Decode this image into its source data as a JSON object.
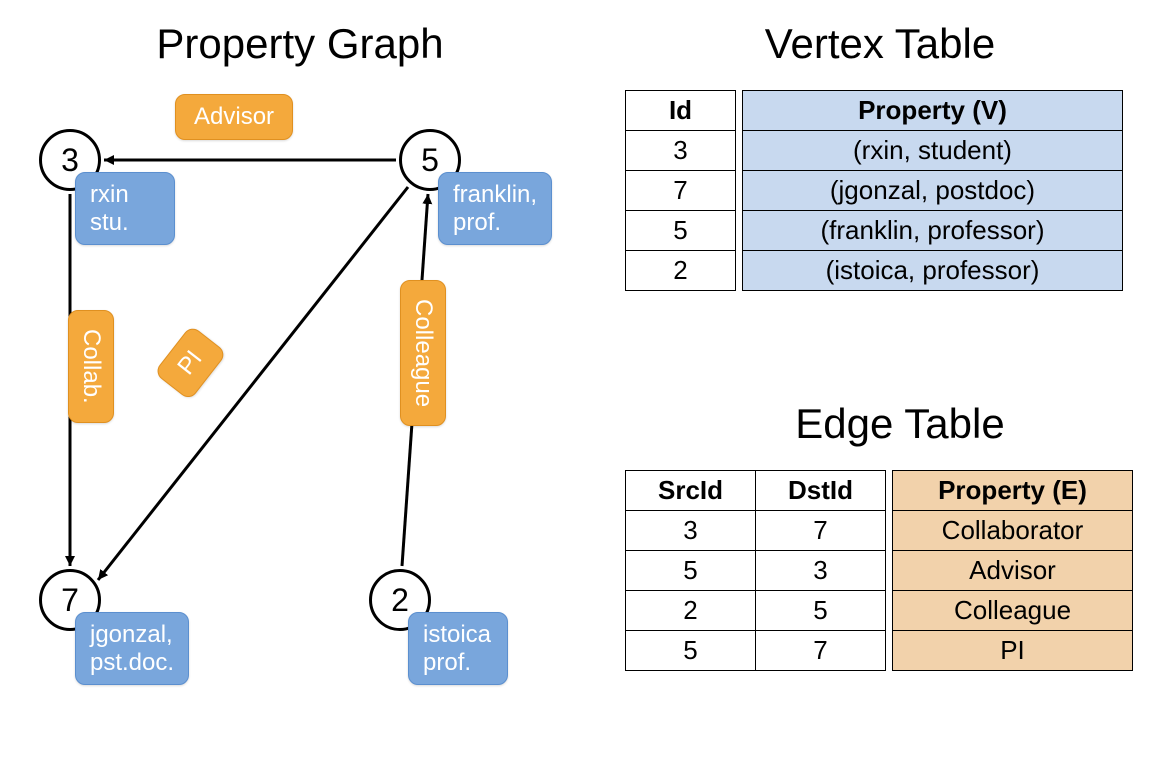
{
  "titles": {
    "graph": "Property Graph",
    "vertex_table": "Vertex Table",
    "edge_table": "Edge Table"
  },
  "vertices": {
    "v3": {
      "id": "3",
      "label_line1": "rxin",
      "label_line2": "stu."
    },
    "v5": {
      "id": "5",
      "label_line1": "franklin,",
      "label_line2": "prof."
    },
    "v7": {
      "id": "7",
      "label_line1": "jgonzal,",
      "label_line2": "pst.doc."
    },
    "v2": {
      "id": "2",
      "label_line1": "istoica",
      "label_line2": "prof."
    }
  },
  "edge_labels": {
    "advisor": "Advisor",
    "collab": "Collab.",
    "pi": "PI",
    "colleague": "Colleague"
  },
  "vertex_table": {
    "headers": {
      "id": "Id",
      "prop": "Property (V)"
    },
    "rows": [
      {
        "id": "3",
        "prop": "(rxin, student)"
      },
      {
        "id": "7",
        "prop": "(jgonzal, postdoc)"
      },
      {
        "id": "5",
        "prop": "(franklin, professor)"
      },
      {
        "id": "2",
        "prop": "(istoica, professor)"
      }
    ]
  },
  "edge_table": {
    "headers": {
      "src": "SrcId",
      "dst": "DstId",
      "prop": "Property (E)"
    },
    "rows": [
      {
        "src": "3",
        "dst": "7",
        "prop": "Collaborator"
      },
      {
        "src": "5",
        "dst": "3",
        "prop": "Advisor"
      },
      {
        "src": "2",
        "dst": "5",
        "prop": "Colleague"
      },
      {
        "src": "5",
        "dst": "7",
        "prop": "PI"
      }
    ]
  },
  "chart_data": {
    "type": "table",
    "description": "Property graph with 4 vertices and 4 directed edges, plus corresponding vertex and edge tables.",
    "vertices": [
      {
        "id": 3,
        "name": "rxin",
        "role": "student"
      },
      {
        "id": 7,
        "name": "jgonzal",
        "role": "postdoc"
      },
      {
        "id": 5,
        "name": "franklin",
        "role": "professor"
      },
      {
        "id": 2,
        "name": "istoica",
        "role": "professor"
      }
    ],
    "edges": [
      {
        "src": 3,
        "dst": 7,
        "property": "Collaborator"
      },
      {
        "src": 5,
        "dst": 3,
        "property": "Advisor"
      },
      {
        "src": 2,
        "dst": 5,
        "property": "Colleague"
      },
      {
        "src": 5,
        "dst": 7,
        "property": "PI"
      }
    ]
  }
}
